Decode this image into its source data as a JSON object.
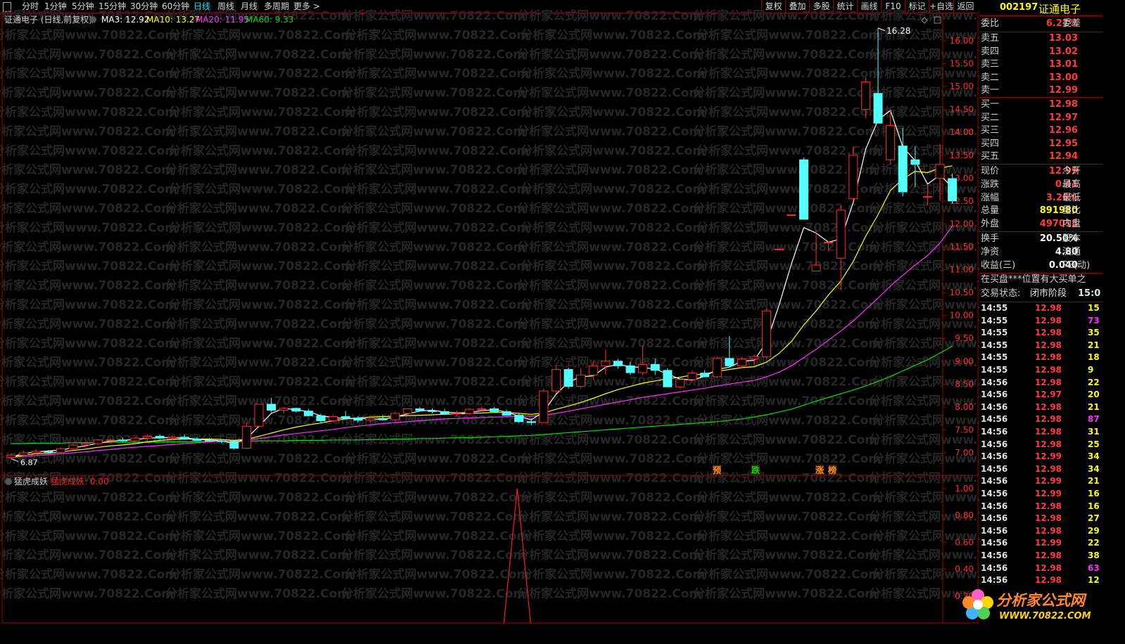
{
  "toolbar": {
    "periods": [
      "分时",
      "1分钟",
      "5分钟",
      "15分钟",
      "30分钟",
      "60分钟",
      "日线",
      "周线",
      "月线",
      "多周期",
      "更多 >"
    ],
    "active_period": "日线",
    "tools": [
      "复权",
      "叠加",
      "多股",
      "统计",
      "画线",
      "F10",
      "标记",
      "+自选",
      "返回"
    ]
  },
  "chart_header": {
    "title": "证通电子 (日线,前复权)",
    "ma3": "MA3: 12.92",
    "ma10": "MA10: 13.27",
    "ma20": "MA20: 11.95",
    "ma60": "MA60: 9.33"
  },
  "indicator_header": {
    "name": "猛虎成妖",
    "value_label": "猛虎成妖: 0.00"
  },
  "colors": {
    "up": "#ff2b2b",
    "down": "#54ffff",
    "ma3": "#ffffff",
    "ma10": "#ffff00",
    "ma20": "#ff30ff",
    "ma60": "#00dd00",
    "frame": "#9b0000",
    "indicator": "#ff1a1a"
  },
  "chart_data": {
    "type": "candlestick",
    "price_axis": {
      "ylim": [
        6.75,
        16.4
      ],
      "ticks": [
        "16.00",
        "15.50",
        "15.00",
        "14.50",
        "14.00",
        "13.50",
        "13.00",
        "12.50",
        "12.00",
        "11.50",
        "11.00",
        "10.50",
        "10.00",
        "9.50",
        "9.00",
        "8.50",
        "8.00",
        "7.50",
        "7.00"
      ]
    },
    "high_label": "16.28",
    "low_label": "6.87",
    "candles": [
      [
        6.9,
        6.98,
        6.87,
        6.95
      ],
      [
        6.95,
        7.05,
        6.92,
        7.0
      ],
      [
        7.0,
        7.08,
        6.97,
        7.03
      ],
      [
        7.03,
        7.06,
        6.98,
        7.01
      ],
      [
        7.01,
        7.12,
        6.99,
        7.09
      ],
      [
        7.09,
        7.2,
        7.06,
        7.17
      ],
      [
        7.17,
        7.24,
        7.13,
        7.2
      ],
      [
        7.2,
        7.3,
        7.16,
        7.28
      ],
      [
        7.28,
        7.32,
        7.22,
        7.28
      ],
      [
        7.28,
        7.33,
        7.23,
        7.26
      ],
      [
        7.26,
        7.35,
        7.22,
        7.32
      ],
      [
        7.32,
        7.4,
        7.26,
        7.36
      ],
      [
        7.36,
        7.4,
        7.3,
        7.32
      ],
      [
        7.32,
        7.38,
        7.27,
        7.34
      ],
      [
        7.34,
        7.39,
        7.28,
        7.3
      ],
      [
        7.3,
        7.34,
        7.25,
        7.27
      ],
      [
        7.27,
        7.32,
        7.23,
        7.26
      ],
      [
        7.26,
        7.3,
        7.21,
        7.25
      ],
      [
        7.25,
        7.28,
        7.07,
        7.1
      ],
      [
        7.1,
        7.66,
        7.08,
        7.58
      ],
      [
        7.58,
        8.07,
        7.55,
        8.06
      ],
      [
        8.06,
        8.2,
        7.88,
        7.93
      ],
      [
        7.93,
        8.0,
        7.85,
        7.97
      ],
      [
        7.97,
        7.99,
        7.88,
        7.91
      ],
      [
        7.91,
        7.96,
        7.8,
        7.81
      ],
      [
        7.81,
        7.85,
        7.65,
        7.7
      ],
      [
        7.7,
        7.82,
        7.67,
        7.79
      ],
      [
        7.79,
        7.91,
        7.72,
        7.76
      ],
      [
        7.76,
        7.8,
        7.66,
        7.71
      ],
      [
        7.71,
        7.78,
        7.66,
        7.75
      ],
      [
        7.75,
        7.83,
        7.7,
        7.72
      ],
      [
        7.72,
        7.9,
        7.68,
        7.86
      ],
      [
        7.86,
        7.95,
        7.82,
        7.96
      ],
      [
        7.96,
        8.0,
        7.9,
        7.92
      ],
      [
        7.92,
        7.97,
        7.86,
        7.9
      ],
      [
        7.9,
        7.96,
        7.85,
        7.85
      ],
      [
        7.85,
        7.92,
        7.8,
        7.86
      ],
      [
        7.86,
        7.98,
        7.82,
        7.95
      ],
      [
        7.95,
        8.0,
        7.9,
        7.96
      ],
      [
        7.96,
        8.0,
        7.88,
        7.9
      ],
      [
        7.9,
        7.94,
        7.82,
        7.82
      ],
      [
        7.82,
        7.86,
        7.66,
        7.68
      ],
      [
        7.68,
        7.75,
        7.6,
        7.66
      ],
      [
        7.66,
        8.4,
        7.65,
        8.35
      ],
      [
        8.35,
        8.9,
        8.3,
        8.82
      ],
      [
        8.82,
        8.86,
        8.4,
        8.45
      ],
      [
        8.45,
        8.85,
        8.4,
        8.7
      ],
      [
        8.7,
        9.0,
        8.6,
        8.9
      ],
      [
        8.9,
        9.25,
        8.7,
        9.0
      ],
      [
        9.0,
        9.05,
        8.84,
        8.9
      ],
      [
        8.9,
        8.98,
        8.7,
        8.75
      ],
      [
        8.75,
        9.35,
        8.7,
        8.93
      ],
      [
        8.93,
        9.05,
        8.7,
        8.8
      ],
      [
        8.8,
        8.85,
        8.44,
        8.44
      ],
      [
        8.44,
        8.65,
        8.4,
        8.6
      ],
      [
        8.6,
        8.8,
        8.55,
        8.74
      ],
      [
        8.74,
        8.8,
        8.66,
        8.66
      ],
      [
        8.66,
        9.1,
        8.62,
        9.06
      ],
      [
        9.06,
        9.55,
        8.88,
        8.9
      ],
      [
        8.9,
        9.1,
        8.85,
        9.05
      ],
      [
        9.05,
        9.15,
        8.93,
        9.1
      ],
      [
        9.1,
        10.15,
        9.05,
        10.1
      ],
      [
        11.45,
        11.45,
        11.45,
        11.45
      ],
      [
        12.2,
        12.2,
        12.2,
        12.2
      ],
      [
        13.4,
        13.45,
        12.1,
        12.1
      ],
      [
        10.97,
        11.85,
        10.97,
        11.1
      ],
      [
        11.6,
        11.6,
        11.4,
        11.6
      ],
      [
        11.25,
        12.4,
        10.55,
        12.3
      ],
      [
        12.55,
        13.7,
        12.5,
        13.5
      ],
      [
        14.5,
        15.2,
        14.3,
        15.1
      ],
      [
        14.85,
        16.28,
        14.2,
        14.2
      ],
      [
        13.4,
        14.5,
        13.3,
        14.15
      ],
      [
        13.7,
        14.1,
        12.6,
        12.7
      ],
      [
        13.4,
        13.7,
        12.8,
        13.3
      ],
      [
        12.6,
        12.85,
        12.4,
        12.6
      ],
      [
        13.0,
        13.75,
        12.5,
        13.3
      ],
      [
        12.99,
        13.1,
        12.45,
        12.5
      ]
    ],
    "ma3": [
      6.9,
      6.99,
      7.02,
      7.04,
      7.06,
      7.11,
      7.15,
      7.21,
      7.25,
      7.27,
      7.29,
      7.32,
      7.33,
      7.33,
      7.32,
      7.3,
      7.28,
      7.26,
      7.2,
      7.31,
      7.58,
      7.86,
      7.97,
      7.94,
      7.9,
      7.81,
      7.77,
      7.75,
      7.75,
      7.74,
      7.73,
      7.78,
      7.85,
      7.91,
      7.93,
      7.89,
      7.87,
      7.88,
      7.92,
      7.94,
      7.89,
      7.8,
      7.72,
      7.9,
      8.28,
      8.54,
      8.66,
      8.68,
      8.87,
      8.93,
      8.88,
      8.86,
      8.83,
      8.72,
      8.61,
      8.59,
      8.67,
      8.82,
      8.87,
      9.0,
      9.02,
      9.42,
      10.22,
      11.12,
      11.92,
      11.8,
      11.6,
      11.67,
      12.47,
      13.63,
      14.27,
      14.48,
      13.68,
      13.38,
      12.87,
      13.07,
      12.8
    ],
    "ma10": [
      6.9,
      6.95,
      6.98,
      6.99,
      7.02,
      7.05,
      7.08,
      7.12,
      7.15,
      7.17,
      7.2,
      7.24,
      7.27,
      7.29,
      7.3,
      7.3,
      7.3,
      7.29,
      7.27,
      7.29,
      7.36,
      7.43,
      7.5,
      7.56,
      7.61,
      7.65,
      7.7,
      7.74,
      7.76,
      7.78,
      7.79,
      7.8,
      7.81,
      7.82,
      7.83,
      7.84,
      7.85,
      7.86,
      7.87,
      7.88,
      7.88,
      7.86,
      7.84,
      7.87,
      7.95,
      8.02,
      8.1,
      8.19,
      8.29,
      8.38,
      8.45,
      8.52,
      8.57,
      8.62,
      8.65,
      8.7,
      8.72,
      8.78,
      8.82,
      8.86,
      8.88,
      8.98,
      9.17,
      9.43,
      9.79,
      10.1,
      10.45,
      10.75,
      11.18,
      11.73,
      12.2,
      12.73,
      12.98,
      13.15,
      13.12,
      13.22,
      13.27
    ],
    "ma20": [
      6.9,
      6.92,
      6.94,
      6.96,
      6.98,
      7.0,
      7.02,
      7.05,
      7.07,
      7.1,
      7.12,
      7.14,
      7.16,
      7.18,
      7.2,
      7.22,
      7.24,
      7.25,
      7.26,
      7.28,
      7.31,
      7.35,
      7.39,
      7.42,
      7.45,
      7.48,
      7.51,
      7.55,
      7.58,
      7.61,
      7.64,
      7.66,
      7.68,
      7.7,
      7.72,
      7.74,
      7.75,
      7.76,
      7.77,
      7.78,
      7.79,
      7.8,
      7.8,
      7.82,
      7.86,
      7.91,
      7.96,
      8.01,
      8.06,
      8.11,
      8.16,
      8.21,
      8.25,
      8.29,
      8.33,
      8.37,
      8.41,
      8.46,
      8.5,
      8.54,
      8.58,
      8.66,
      8.76,
      8.9,
      9.08,
      9.26,
      9.46,
      9.66,
      9.88,
      10.13,
      10.38,
      10.64,
      10.88,
      11.1,
      11.31,
      11.58,
      11.95
    ],
    "ma60": [
      7.2,
      7.2,
      7.21,
      7.21,
      7.21,
      7.22,
      7.22,
      7.22,
      7.23,
      7.23,
      7.23,
      7.23,
      7.24,
      7.24,
      7.24,
      7.24,
      7.25,
      7.25,
      7.25,
      7.25,
      7.26,
      7.26,
      7.26,
      7.27,
      7.27,
      7.27,
      7.28,
      7.28,
      7.28,
      7.29,
      7.29,
      7.3,
      7.3,
      7.31,
      7.31,
      7.32,
      7.33,
      7.33,
      7.34,
      7.35,
      7.36,
      7.37,
      7.38,
      7.4,
      7.42,
      7.44,
      7.46,
      7.48,
      7.5,
      7.52,
      7.54,
      7.56,
      7.58,
      7.6,
      7.62,
      7.64,
      7.66,
      7.68,
      7.71,
      7.74,
      7.78,
      7.83,
      7.89,
      7.95,
      8.04,
      8.13,
      8.21,
      8.29,
      8.37,
      8.46,
      8.56,
      8.67,
      8.79,
      8.91,
      9.03,
      9.18,
      9.33
    ],
    "markers": [
      "预",
      "跌",
      "涨",
      "榜"
    ],
    "indicator": {
      "ylim": [
        0,
        1.05
      ],
      "ticks": [
        "1.00",
        "0.80",
        "0.60",
        "0.40",
        "0.20"
      ],
      "spike_index": 42,
      "spike_value": 1.0
    }
  },
  "right_panel": {
    "code": "002197",
    "name": "证通电子",
    "weibi_label": "委比",
    "weibi_value": "6.21%",
    "weicha_label": "委差",
    "asks": [
      {
        "label": "卖五",
        "price": "13.03"
      },
      {
        "label": "卖四",
        "price": "13.02"
      },
      {
        "label": "卖三",
        "price": "13.01"
      },
      {
        "label": "卖二",
        "price": "13.00"
      },
      {
        "label": "卖一",
        "price": "12.99"
      }
    ],
    "bids": [
      {
        "label": "买一",
        "price": "12.98"
      },
      {
        "label": "买二",
        "price": "12.97"
      },
      {
        "label": "买三",
        "price": "12.96"
      },
      {
        "label": "买四",
        "price": "12.95"
      },
      {
        "label": "买五",
        "price": "12.94"
      }
    ],
    "stats1": [
      {
        "label": "现价",
        "value": "12.99",
        "right": "今开",
        "cls": "red"
      },
      {
        "label": "涨跌",
        "value": "0.41",
        "right": "最高",
        "cls": "red"
      },
      {
        "label": "涨幅",
        "value": "3.26%",
        "right": "最低",
        "cls": "red"
      },
      {
        "label": "总量",
        "value": "891980",
        "right": "量比",
        "cls": "ylw"
      },
      {
        "label": "外盘",
        "value": "497013",
        "right": "内盘",
        "cls": "red"
      }
    ],
    "stats2": [
      {
        "label": "换手",
        "value": "20.50%",
        "right": "股本",
        "cls": "wht"
      },
      {
        "label": "净资",
        "value": "4.80",
        "right": "流通",
        "cls": "wht"
      },
      {
        "label": "收益(三)",
        "value": "0.040",
        "right": "PE(动)",
        "cls": "wht"
      }
    ],
    "notice": "在买盘***位置有大买单之",
    "status_label": "交易状态:",
    "status_value": "闭市阶段",
    "status_time": "15:0",
    "ticks": [
      {
        "time": "14:55",
        "price": "12.98",
        "vol": "15",
        "pc": "red",
        "vc": "ylw"
      },
      {
        "time": "14:55",
        "price": "12.98",
        "vol": "73",
        "pc": "red",
        "vc": "mag"
      },
      {
        "time": "14:55",
        "price": "12.98",
        "vol": "35",
        "pc": "red",
        "vc": "ylw"
      },
      {
        "time": "14:55",
        "price": "12.98",
        "vol": "21",
        "pc": "red",
        "vc": "ylw"
      },
      {
        "time": "14:55",
        "price": "12.98",
        "vol": "18",
        "pc": "red",
        "vc": "ylw"
      },
      {
        "time": "14:55",
        "price": "12.98",
        "vol": "9",
        "pc": "red",
        "vc": "ylw"
      },
      {
        "time": "14:56",
        "price": "12.98",
        "vol": "22",
        "pc": "red",
        "vc": "ylw"
      },
      {
        "time": "14:56",
        "price": "12.97",
        "vol": "20",
        "pc": "red",
        "vc": "ylw"
      },
      {
        "time": "14:56",
        "price": "12.98",
        "vol": "21",
        "pc": "red",
        "vc": "ylw"
      },
      {
        "time": "14:56",
        "price": "12.98",
        "vol": "87",
        "pc": "red",
        "vc": "mag"
      },
      {
        "time": "14:56",
        "price": "12.98",
        "vol": "31",
        "pc": "red",
        "vc": "ylw"
      },
      {
        "time": "14:56",
        "price": "12.98",
        "vol": "25",
        "pc": "red",
        "vc": "ylw"
      },
      {
        "time": "14:56",
        "price": "12.99",
        "vol": "34",
        "pc": "red",
        "vc": "ylw"
      },
      {
        "time": "14:56",
        "price": "12.98",
        "vol": "34",
        "pc": "red",
        "vc": "ylw"
      },
      {
        "time": "14:56",
        "price": "12.99",
        "vol": "21",
        "pc": "red",
        "vc": "ylw"
      },
      {
        "time": "14:56",
        "price": "12.99",
        "vol": "16",
        "pc": "red",
        "vc": "ylw"
      },
      {
        "time": "14:56",
        "price": "12.98",
        "vol": "16",
        "pc": "red",
        "vc": "ylw"
      },
      {
        "time": "14:56",
        "price": "12.98",
        "vol": "27",
        "pc": "red",
        "vc": "ylw"
      },
      {
        "time": "14:56",
        "price": "12.98",
        "vol": "29",
        "pc": "red",
        "vc": "ylw"
      },
      {
        "time": "14:56",
        "price": "12.99",
        "vol": "22",
        "pc": "red",
        "vc": "ylw"
      },
      {
        "time": "14:56",
        "price": "12.98",
        "vol": "38",
        "pc": "red",
        "vc": "ylw"
      },
      {
        "time": "14:56",
        "price": "12.98",
        "vol": "63",
        "pc": "red",
        "vc": "mag"
      },
      {
        "time": "14:56",
        "price": "12.98",
        "vol": "12",
        "pc": "red",
        "vc": "ylw"
      }
    ]
  },
  "watermark": "分析家公式网www.70822.Com",
  "logo": {
    "text": "分析家公式网",
    "url": "WWW.70822.COM"
  }
}
